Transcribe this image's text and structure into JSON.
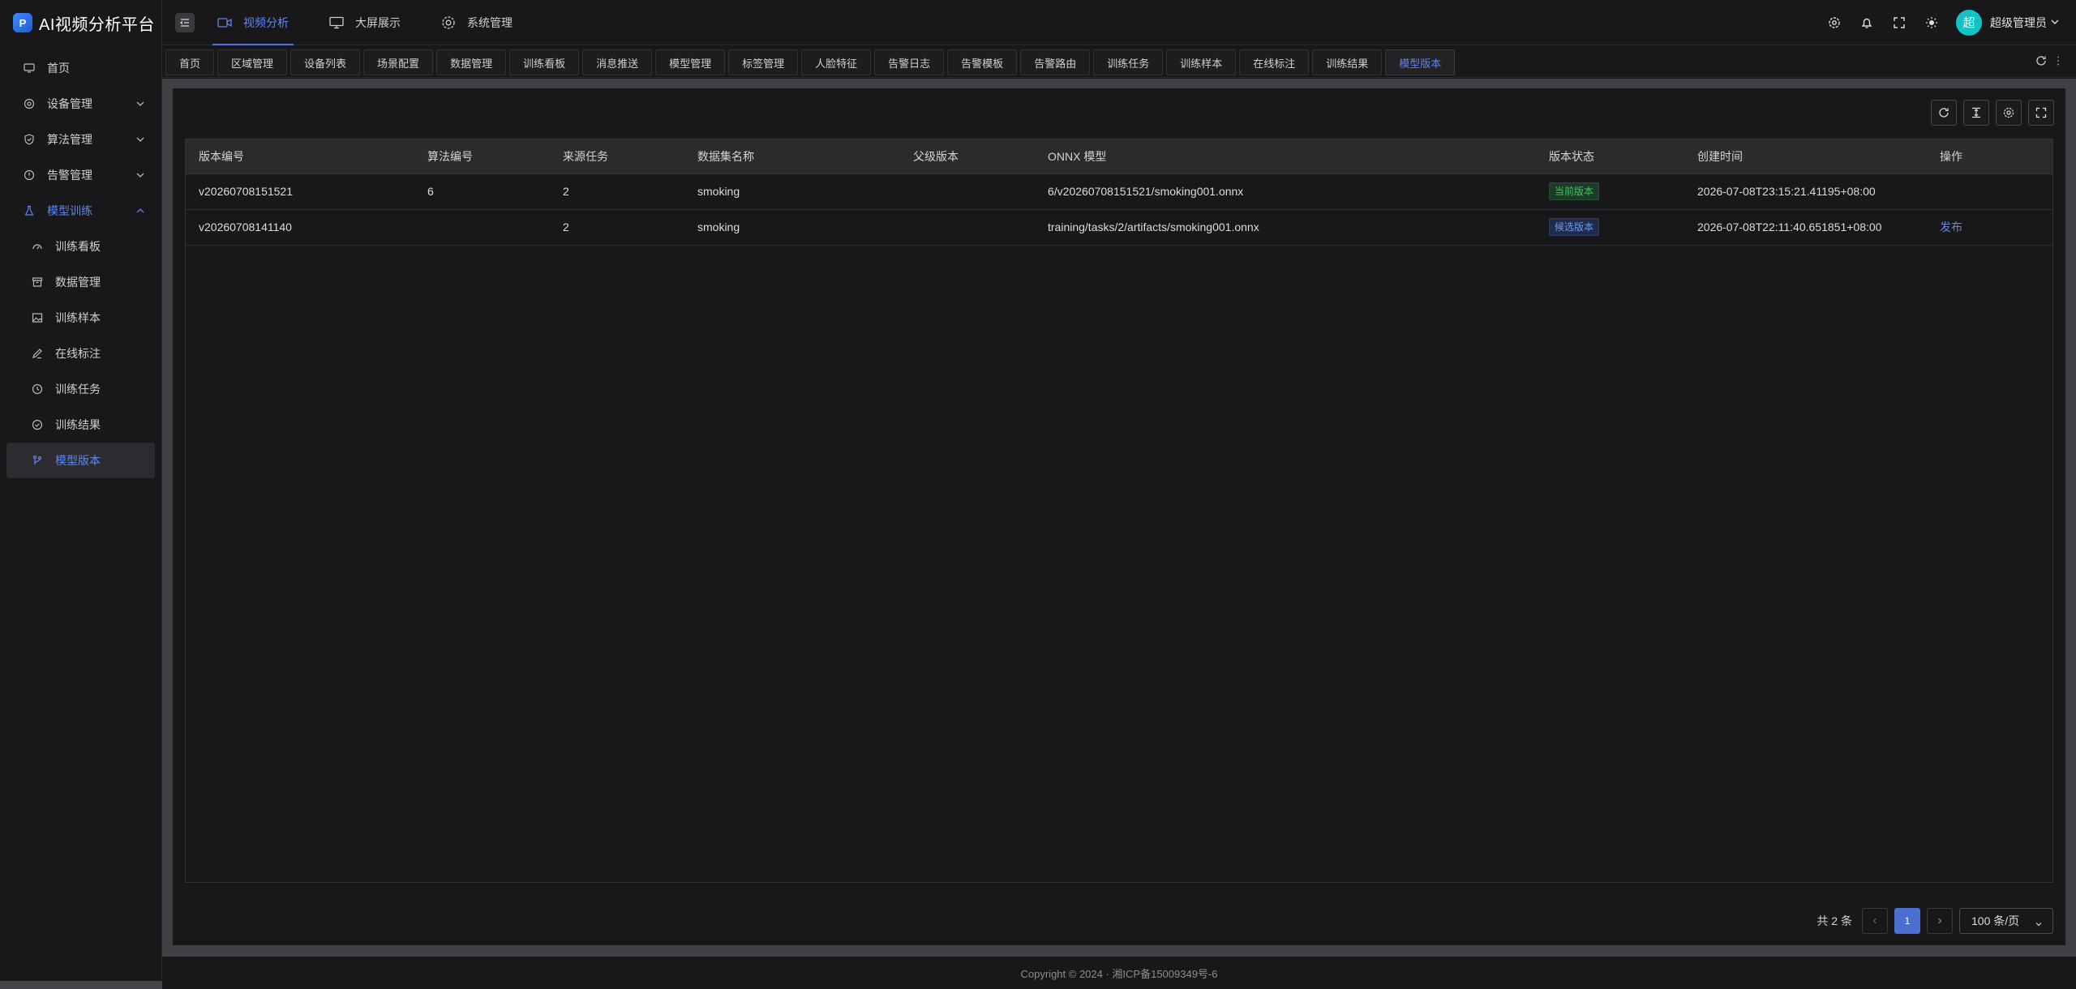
{
  "app": {
    "title": "AI视频分析平台",
    "logo_icon": "app-logo-icon"
  },
  "sidebar": {
    "items": [
      {
        "label": "首页",
        "icon": "monitor-icon"
      },
      {
        "label": "设备管理",
        "icon": "gear-icon",
        "expandable": true
      },
      {
        "label": "算法管理",
        "icon": "shield-icon",
        "expandable": true
      },
      {
        "label": "告警管理",
        "icon": "alert-circle-icon",
        "expandable": true
      },
      {
        "label": "模型训练",
        "icon": "flask-icon",
        "expandable": true,
        "open": true
      }
    ],
    "sub_items": [
      {
        "label": "训练看板",
        "icon": "dashboard-icon"
      },
      {
        "label": "数据管理",
        "icon": "archive-icon"
      },
      {
        "label": "训练样本",
        "icon": "image-icon"
      },
      {
        "label": "在线标注",
        "icon": "pencil-icon"
      },
      {
        "label": "训练任务",
        "icon": "clock-icon"
      },
      {
        "label": "训练结果",
        "icon": "check-circle-icon"
      },
      {
        "label": "模型版本",
        "icon": "branch-icon",
        "active": true
      }
    ]
  },
  "header": {
    "nav": [
      {
        "label": "视频分析",
        "icon": "video-icon",
        "active": true
      },
      {
        "label": "大屏展示",
        "icon": "monitor-icon"
      },
      {
        "label": "系统管理",
        "icon": "gear-icon"
      }
    ],
    "user": {
      "avatar_text": "超",
      "name": "超级管理员"
    }
  },
  "tabs": [
    "首页",
    "区域管理",
    "设备列表",
    "场景配置",
    "数据管理",
    "训练看板",
    "消息推送",
    "模型管理",
    "标签管理",
    "人脸特征",
    "告警日志",
    "告警模板",
    "告警路由",
    "训练任务",
    "训练样本",
    "在线标注",
    "训练结果",
    "模型版本"
  ],
  "active_tab": "模型版本",
  "table": {
    "columns": [
      "版本编号",
      "算法编号",
      "来源任务",
      "数据集名称",
      "父级版本",
      "ONNX 模型",
      "版本状态",
      "创建时间",
      "操作"
    ],
    "rows": [
      {
        "version": "v20260708151521",
        "algorithm": "6",
        "task": "2",
        "dataset": "smoking",
        "parent": "",
        "onnx": "6/v20260708151521/smoking001.onnx",
        "status": "当前版本",
        "status_type": "current",
        "created": "2026-07-08T23:15:21.41195+08:00",
        "action": ""
      },
      {
        "version": "v20260708141140",
        "algorithm": "",
        "task": "2",
        "dataset": "smoking",
        "parent": "",
        "onnx": "training/tasks/2/artifacts/smoking001.onnx",
        "status": "候选版本",
        "status_type": "candidate",
        "created": "2026-07-08T22:11:40.651851+08:00",
        "action": "发布"
      }
    ]
  },
  "pagination": {
    "total_text": "共 2 条",
    "current_page": "1",
    "page_size": "100 条/页"
  },
  "footer": {
    "text": "Copyright © 2024 · 湘ICP备15009349号-6"
  },
  "colors": {
    "accent": "#4a74e8",
    "success": "#49c067",
    "background": "#18181a"
  }
}
